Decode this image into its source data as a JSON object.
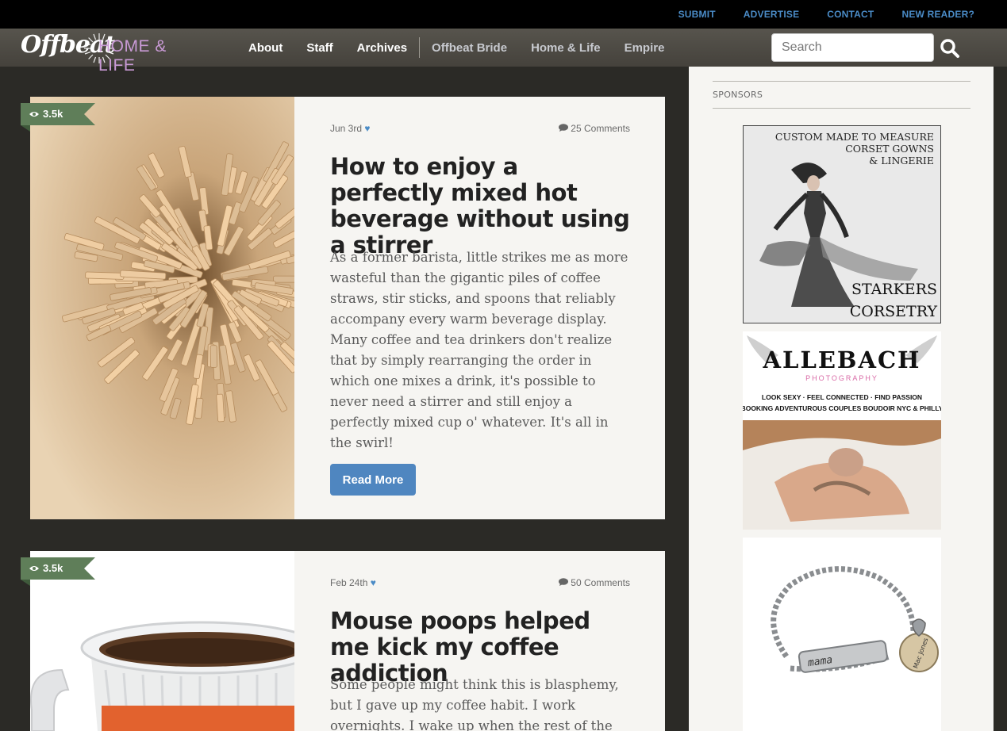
{
  "topbar": {
    "links": [
      "SUBMIT",
      "ADVERTISE",
      "CONTACT",
      "NEW READER?"
    ]
  },
  "brand": {
    "logo_word": "Offbeat",
    "logo_sub": "HOME & LIFE",
    "logo_color": "#c99ad6"
  },
  "nav": {
    "primary": [
      "About",
      "Staff",
      "Archives"
    ],
    "sister": [
      "Offbeat Bride",
      "Home & Life",
      "Empire"
    ]
  },
  "search": {
    "placeholder": "Search",
    "icon": "search-icon"
  },
  "articles": [
    {
      "views": "3.5k",
      "date": "Jun 3rd",
      "heart": "♥",
      "comments": "25 Comments",
      "title": "How to enjoy a perfectly mixed hot beverage without using a stirrer",
      "excerpt": "As a former barista, little strikes me as more wasteful than the gigantic piles of coffee straws, stir sticks, and spoons that reliably accompany every warm beverage display. Many coffee and tea drinkers don't realize that by simply rearranging the order in which one mixes a drink, it's possible to never need a stirrer and still enjoy a perfectly mixed cup o' whatever. It's all in the swirl!",
      "read_more": "Read More"
    },
    {
      "views": "3.5k",
      "date": "Feb 24th",
      "heart": "♥",
      "comments": "50 Comments",
      "title": "Mouse poops helped me kick my coffee addiction",
      "excerpt": "Some people might think this is blasphemy, but I gave up my coffee habit. I work overnights. I wake up when the rest of the"
    }
  ],
  "sidebar": {
    "heading": "SPONSORS",
    "ads": [
      {
        "line1": "CUSTOM MADE TO MEASURE",
        "line2": "CORSET GOWNS",
        "line3": "& LINGERIE",
        "brand1": "STARKERS",
        "brand2": "CORSETRY"
      },
      {
        "brand": "ALLEBACH",
        "sub": "PHOTOGRAPHY",
        "tag1": "LOOK SEXY · FEEL CONNECTED · FIND PASSION",
        "tag2": "BOOKING ADVENTUROUS COUPLES BOUDOIR NYC & PHILLY"
      },
      {
        "charm1": "mama",
        "charm2": "Mac Jones"
      }
    ]
  },
  "colors": {
    "link_blue": "#4a8bc6",
    "views_green": "#5f7e59",
    "button_blue": "#4f86c0"
  }
}
